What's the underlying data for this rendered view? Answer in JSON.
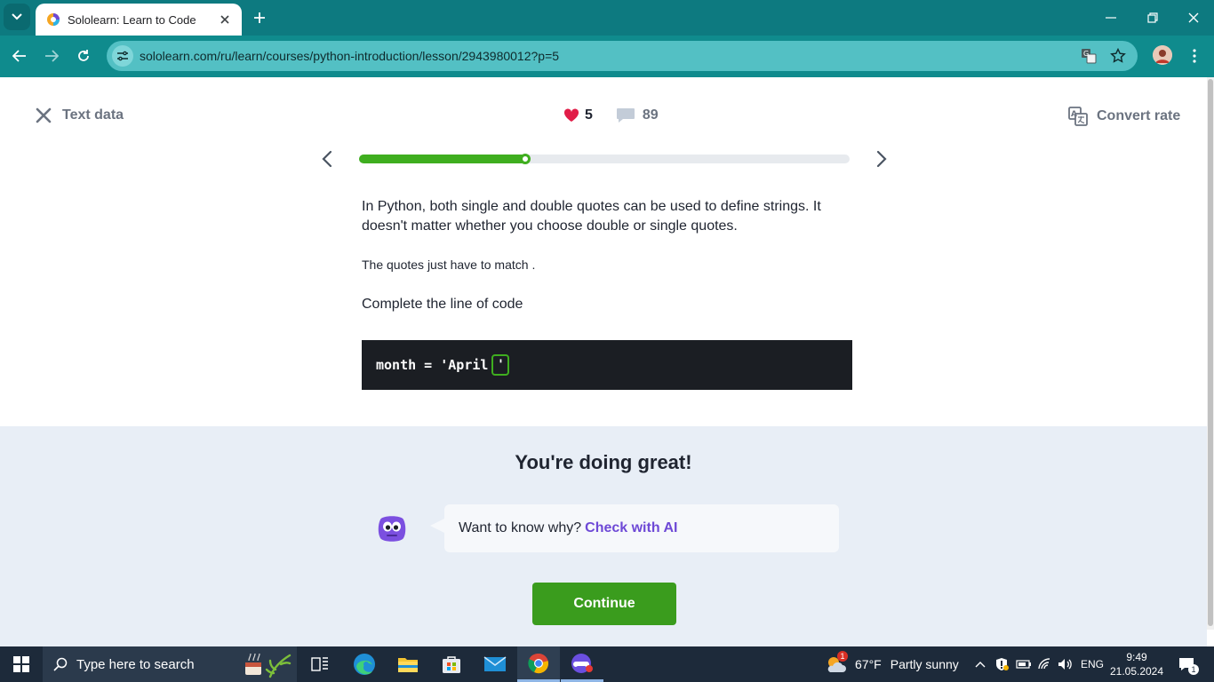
{
  "browser": {
    "tab_title": "Sololearn: Learn to Code",
    "url": "sololearn.com/ru/learn/courses/python-introduction/lesson/2943980012?p=5"
  },
  "lesson_header": {
    "close_label": "Text data",
    "hearts": "5",
    "comments": "89",
    "translate_label": "Convert rate"
  },
  "progress": {
    "fraction": 0.34
  },
  "content": {
    "paragraph1": "In Python, both single and double quotes can be used to define strings. It doesn't matter whether you choose double or single quotes.",
    "paragraph2": "The quotes just have to match .",
    "paragraph3": "Complete the line of code",
    "code_prefix": "month = 'April",
    "code_answer": "'"
  },
  "feedback": {
    "title": "You're doing great!",
    "prompt": "Want to know why?",
    "ai_link": "Check with AI",
    "continue_label": "Continue"
  },
  "taskbar": {
    "search_placeholder": "Type here to search",
    "weather_temp": "67°F",
    "weather_desc": "Partly sunny",
    "weather_badge": "1",
    "lang": "ENG",
    "time": "9:49",
    "date": "21.05.2024",
    "notification_count": "1"
  },
  "colors": {
    "accent_green": "#3fae1f",
    "heart": "#e11d48",
    "ai_link": "#6e49d6",
    "browser_frame": "#0d7a80"
  }
}
